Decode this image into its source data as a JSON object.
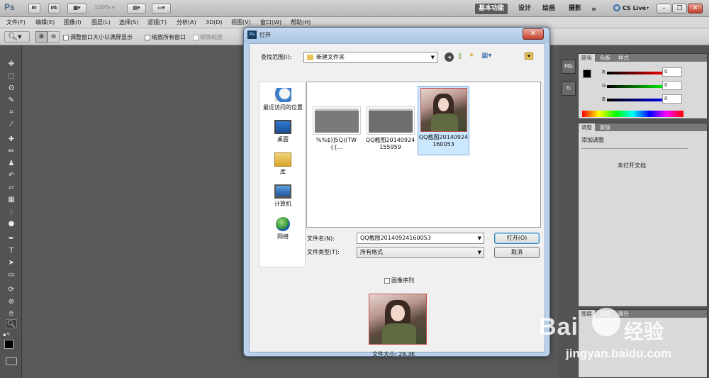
{
  "app": {
    "logo": "Ps",
    "top_buttons": [
      "Br",
      "Mb"
    ],
    "zoom": "100%",
    "workspaces": [
      "基本功能",
      "设计",
      "绘画",
      "摄影"
    ],
    "more": "»",
    "cslive": "CS Live"
  },
  "menu": [
    "文件(F)",
    "编辑(E)",
    "图像(I)",
    "图层(L)",
    "选择(S)",
    "滤镜(T)",
    "分析(A)",
    "3D(D)",
    "视图(V)",
    "窗口(W)",
    "帮助(H)"
  ],
  "options": {
    "resize_windows": "调整窗口大小以满屏显示",
    "zoom_all": "缩放所有窗口",
    "scrubby": "细微缩放"
  },
  "color_panel": {
    "tabs": [
      "颜色",
      "色板",
      "样式"
    ],
    "channels": [
      {
        "name": "R",
        "value": "0"
      },
      {
        "name": "G",
        "value": "0"
      },
      {
        "name": "B",
        "value": "0"
      }
    ]
  },
  "adjust_panel": {
    "tabs": [
      "调整",
      "蒙版"
    ],
    "title": "添加调整",
    "message": "未打开文档"
  },
  "layers_panel": {
    "tabs": [
      "图层",
      "通道",
      "路径"
    ]
  },
  "dialog": {
    "title": "打开",
    "look_in_label": "查找范围(I):",
    "look_in_value": "新建文件夹",
    "places": [
      "最近访问的位置",
      "桌面",
      "库",
      "计算机",
      "网络"
    ],
    "files": [
      {
        "name": "%%$)]5Q)(TW{{..."
      },
      {
        "name": "QQ截图20140924155959"
      },
      {
        "name": "QQ截图20140924160053"
      }
    ],
    "filename_label": "文件名(N):",
    "filename_value": "QQ截图20140924160053",
    "filetype_label": "文件类型(T):",
    "filetype_value": "所有格式",
    "open_button": "打开(O)",
    "cancel_button": "取消",
    "image_sequence": "图像序列",
    "file_size": "文件大小: 28.3K"
  },
  "watermark": {
    "brand": "Bai",
    "brand2": "经验",
    "url": "jingyan.baidu.com"
  },
  "colors": {
    "dialog_frame": "#b9d1ea",
    "app_bg": "#595959",
    "selection": "#cce8ff"
  }
}
